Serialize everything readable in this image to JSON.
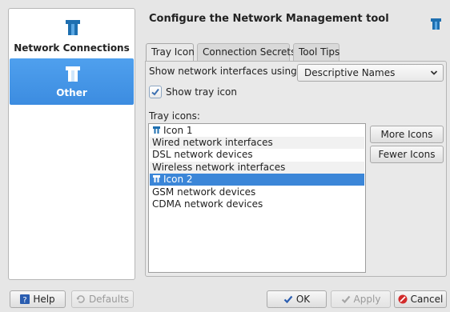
{
  "sidebar": {
    "items": [
      {
        "label": "Network Connections",
        "icon": "network-manager-icon"
      },
      {
        "label": "Other",
        "icon": "network-manager-icon",
        "selected": true
      }
    ]
  },
  "header": {
    "title": "Configure the Network Management tool",
    "icon": "network-manager-icon"
  },
  "tabs": [
    {
      "label": "Tray Icon",
      "active": true
    },
    {
      "label": "Connection Secrets"
    },
    {
      "label": "Tool Tips"
    }
  ],
  "tray_tab": {
    "show_label": "Show network interfaces using:",
    "select_value": "Descriptive Names",
    "show_tray_icon_label": "Show tray icon",
    "show_tray_icon_checked": true,
    "tray_icons_label": "Tray icons:",
    "list": [
      {
        "label": "Icon 1",
        "icon": "network-manager-icon"
      },
      {
        "label": "Wired network interfaces"
      },
      {
        "label": "DSL network devices"
      },
      {
        "label": "Wireless network interfaces"
      },
      {
        "label": "Icon 2",
        "icon": "network-manager-icon",
        "selected": true
      },
      {
        "label": "GSM network devices"
      },
      {
        "label": "CDMA network devices"
      }
    ],
    "more_icons_label": "More Icons",
    "fewer_icons_label": "Fewer Icons"
  },
  "footer": {
    "help_label": "Help",
    "defaults_label": "Defaults",
    "ok_label": "OK",
    "apply_label": "Apply",
    "cancel_label": "Cancel"
  },
  "colors": {
    "accent": "#3b86d8",
    "window_bg": "#e6e6e6",
    "icon_blue": "#1e6fb0"
  }
}
